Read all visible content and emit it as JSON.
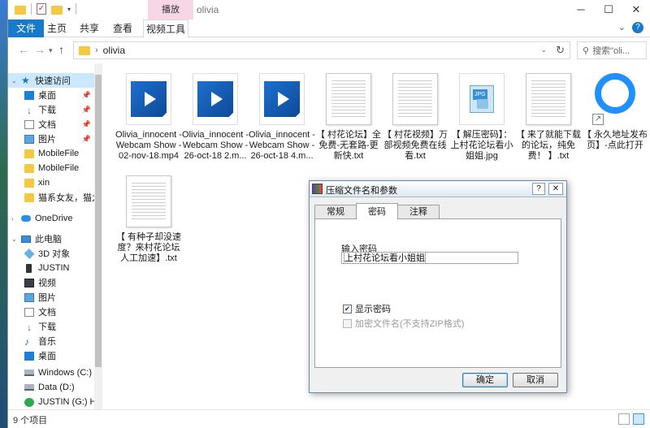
{
  "window": {
    "title": "olivia",
    "tool_tab_header": "播放",
    "controls": {
      "minimize": "─",
      "maximize": "☐",
      "close": "✕"
    }
  },
  "ribbon": {
    "tabs": {
      "file": "文件",
      "home": "主页",
      "share": "共享",
      "view": "查看",
      "video_tools": "视频工具"
    },
    "help": "?"
  },
  "address": {
    "path": "olivia",
    "search_placeholder": "搜索\"oli..."
  },
  "nav_pane": {
    "quick_access": "快速访问",
    "desktop": "桌面",
    "downloads": "下载",
    "documents": "文档",
    "pictures": "图片",
    "mobile_file_1": "MobileFile",
    "mobile_file_2": "MobileFile",
    "xin": "xin",
    "cat_folder": "猫系女友，猫九",
    "onedrive": "OneDrive",
    "this_pc": "此电脑",
    "objects_3d": "3D 对象",
    "justin_phone": "JUSTIN",
    "videos": "视频",
    "pictures_pc": "图片",
    "documents_pc": "文档",
    "downloads_pc": "下载",
    "music": "音乐",
    "desktop_pc": "桌面",
    "windows_c": "Windows (C:)",
    "data_d": "Data (D:)",
    "justin_g": "JUSTIN (G:) Hi$"
  },
  "files": [
    {
      "name": "Olivia_innocent - Webcam Show - 02-nov-18.mp4",
      "kind": "video"
    },
    {
      "name": "Olivia_innocent - Webcam Show - 26-oct-18 2.m...",
      "kind": "video"
    },
    {
      "name": "Olivia_innocent - Webcam Show - 26-oct-18 4.m...",
      "kind": "video"
    },
    {
      "name": "【 村花论坛】全免费-无套路-更新快.txt",
      "kind": "txt"
    },
    {
      "name": "【 村花视频】万部视频免费在线看.txt",
      "kind": "txt"
    },
    {
      "name": "【 解压密码】：上村花论坛看小姐姐.jpg",
      "kind": "jpg"
    },
    {
      "name": "【 来了就能下载的论坛，纯免费！ 】.txt",
      "kind": "txt"
    },
    {
      "name": "【 永久地址发布页】-点此打开",
      "kind": "url"
    },
    {
      "name": "【 有种子却没速度？来村花论坛人工加速】.txt",
      "kind": "txt"
    }
  ],
  "status": {
    "item_count": "9 个项目"
  },
  "dialog": {
    "title": "压缩文件名和参数",
    "help": "?",
    "close": "✕",
    "tabs": {
      "general": "常规",
      "password": "密码",
      "comment": "注释"
    },
    "password_label": "输入密码",
    "password_value": "上村花论坛看小姐姐",
    "show_password": "显示密码",
    "show_password_checked": true,
    "encrypt_names": "加密文件名(不支持ZIP格式)",
    "encrypt_names_checked": false,
    "ok": "确定",
    "cancel": "取消"
  }
}
